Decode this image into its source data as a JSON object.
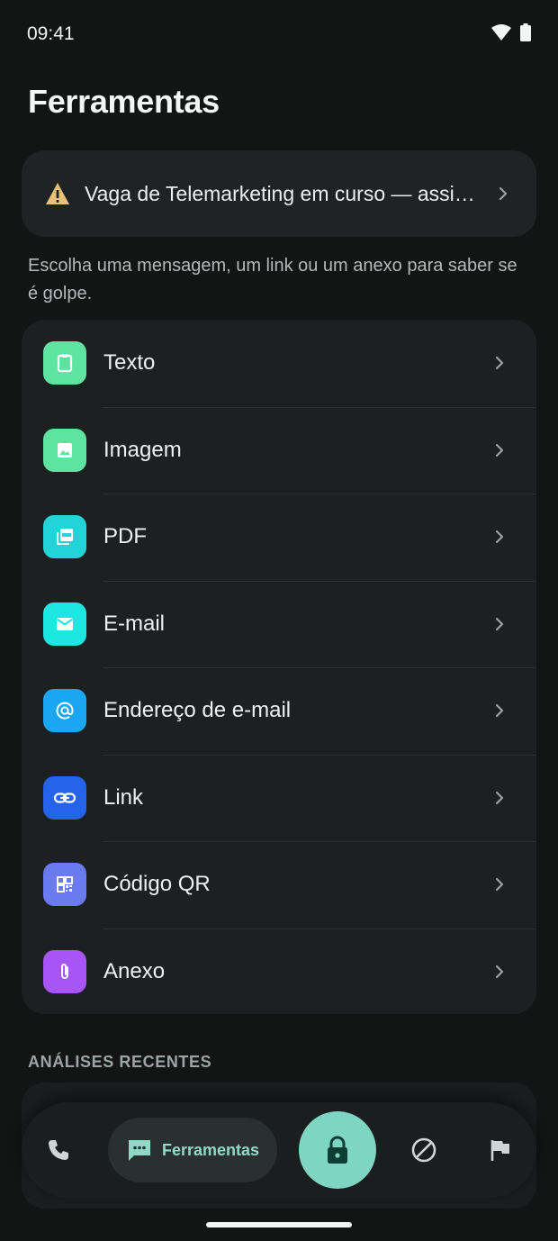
{
  "status_bar": {
    "time": "09:41"
  },
  "header": {
    "title": "Ferramentas"
  },
  "alert": {
    "text": "Vaga de Telemarketing em curso — assine já"
  },
  "intro": {
    "text": "Escolha uma mensagem, um link ou um anexo para saber se é golpe."
  },
  "tools": [
    {
      "label": "Texto",
      "icon": "clipboard-icon",
      "color": "#5fe3a1"
    },
    {
      "label": "Imagem",
      "icon": "image-icon",
      "color": "#5fe3a1"
    },
    {
      "label": "PDF",
      "icon": "pdf-icon",
      "color": "#22d3d8"
    },
    {
      "label": "E-mail",
      "icon": "mail-icon",
      "color": "#1ee6e0"
    },
    {
      "label": "Endereço de e-mail",
      "icon": "at-sign-icon",
      "color": "#1aa6f2"
    },
    {
      "label": "Link",
      "icon": "link-icon",
      "color": "#2563eb"
    },
    {
      "label": "Código QR",
      "icon": "qr-code-icon",
      "color": "#6a7bf0"
    },
    {
      "label": "Anexo",
      "icon": "paperclip-icon",
      "color": "#a855f7"
    }
  ],
  "recent": {
    "title": "ANÁLISES RECENTES"
  },
  "nav": {
    "active_label": "Ferramentas",
    "accent": "#7dd5c2"
  }
}
